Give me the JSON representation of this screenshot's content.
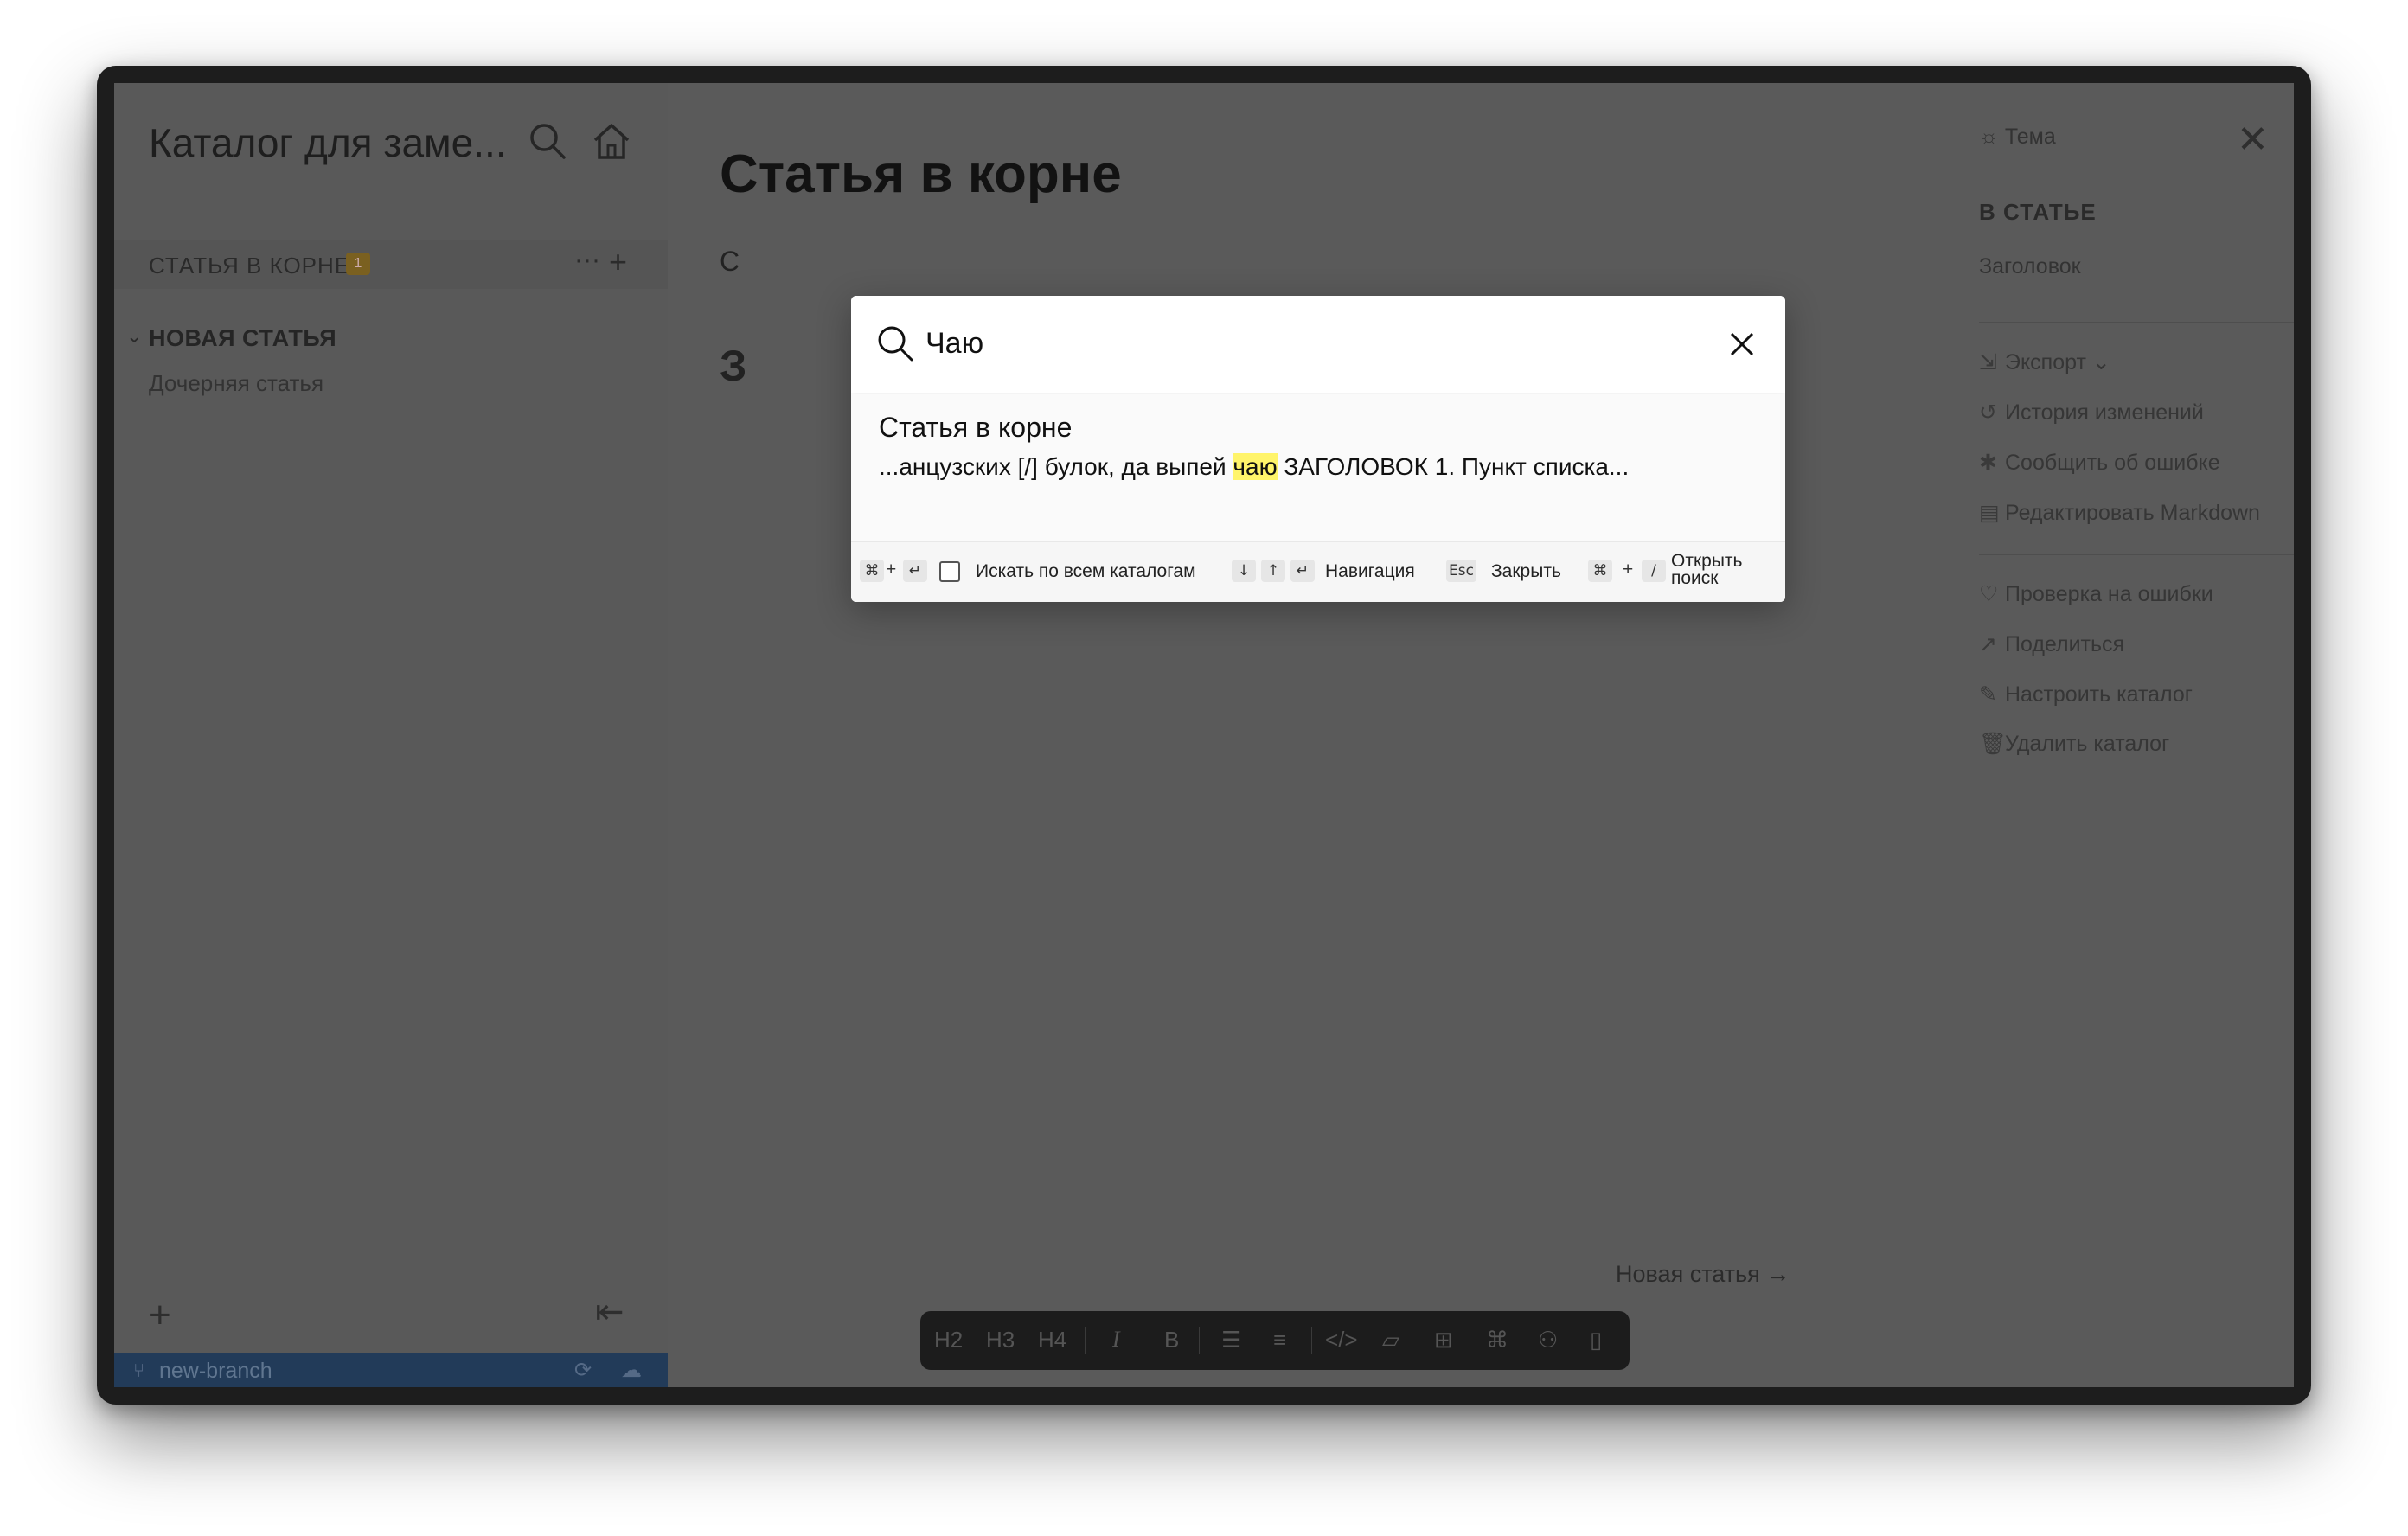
{
  "sidebar": {
    "catalog_title": "Каталог для заме...",
    "category_label": "СТАТЬЯ В КОРНЕ",
    "category_badge": "1",
    "tree_parent": "НОВАЯ СТАТЬЯ",
    "tree_child": "Дочерняя статья",
    "branch": "new-branch"
  },
  "article": {
    "title": "Статья в корне",
    "text_fragment": "С",
    "heading_fragment": "З",
    "next_link": "Новая статья →"
  },
  "toolbar": {
    "items": [
      "H2",
      "H3",
      "H4",
      "I",
      "B",
      "bulleted-list",
      "numbered-list",
      "code",
      "note",
      "table",
      "diagram",
      "graph",
      "file"
    ]
  },
  "right_panel": {
    "theme": "Тема",
    "section_title": "В СТАТЬЕ",
    "toc_item": "Заголовок",
    "export": "Экспорт",
    "history": "История изменений",
    "report_bug": "Сообщить об ошибке",
    "edit_markdown": "Редактировать Markdown",
    "check_errors": "Проверка на ошибки",
    "share": "Поделиться",
    "configure_catalog": "Настроить каталог",
    "delete_catalog": "Удалить каталог"
  },
  "search": {
    "query": "Чаю",
    "result": {
      "title": "Статья в корне",
      "snippet_before": "...анцузских [/] булок, да выпей ",
      "snippet_match": "чаю",
      "snippet_after": " ЗАГОЛОВОК 1. Пункт списка..."
    },
    "footer": {
      "search_all_label": "Искать по всем каталогам",
      "nav_label": "Навигация",
      "esc_key": "Esc",
      "close_label": "Закрыть",
      "open_label_line1": "Открыть",
      "open_label_line2": "поиск"
    }
  }
}
